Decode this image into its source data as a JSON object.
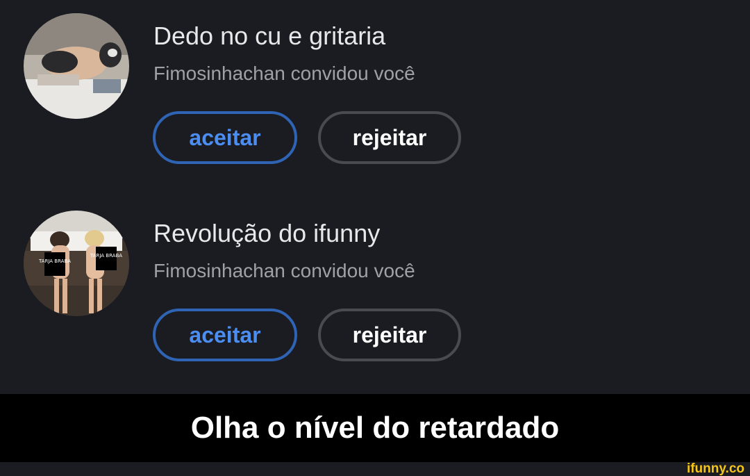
{
  "invites": [
    {
      "group_name": "Dedo no cu e gritaria",
      "inviter_line": "Fimosinhachan convidou você",
      "accept_label": "aceitar",
      "reject_label": "rejeitar"
    },
    {
      "group_name": "Revolução do ifunny",
      "inviter_line": "Fimosinhachan convidou você",
      "accept_label": "aceitar",
      "reject_label": "rejeitar",
      "avatar_censor_labels": [
        "TARJA BRABA",
        "TARJA BRABA"
      ]
    }
  ],
  "caption": "Olha o nível do retardado",
  "watermark": "ifunny.co",
  "colors": {
    "background": "#1b1c21",
    "accept_accent": "#4b8df0",
    "accept_border": "#2f63b3",
    "reject_border": "#4a4b50",
    "caption_bar": "#000000",
    "watermark": "#f5c518"
  }
}
